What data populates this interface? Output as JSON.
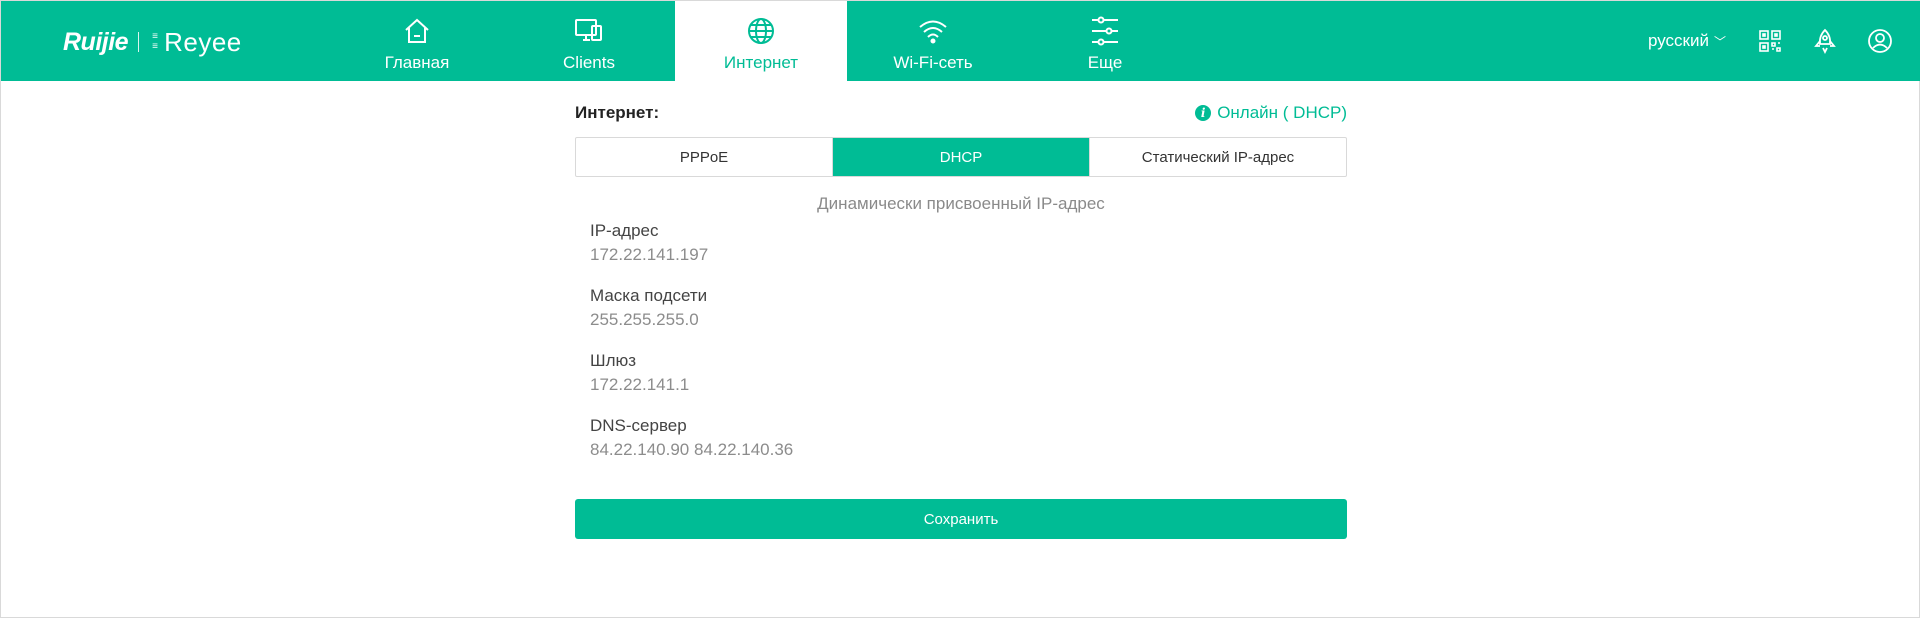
{
  "brand": {
    "logo_primary": "Ruijie",
    "logo_secondary": "Reyee",
    "primary_color": "#00bc95"
  },
  "nav": {
    "tabs": [
      {
        "label": "Главная",
        "icon": "home-icon",
        "active": false
      },
      {
        "label": "Clients",
        "icon": "monitor-icon",
        "active": false
      },
      {
        "label": "Интернет",
        "icon": "globe-icon",
        "active": true
      },
      {
        "label": "Wi-Fi-сеть",
        "icon": "wifi-icon",
        "active": false
      },
      {
        "label": "Еще",
        "icon": "settings-sliders-icon",
        "active": false
      }
    ]
  },
  "toolbar": {
    "language": "русский",
    "icons": [
      "qr-code-icon",
      "rocket-icon",
      "user-icon"
    ]
  },
  "internet": {
    "title": "Интернет:",
    "status": "Онлайн ( DHCP)",
    "modes": [
      "PPPoE",
      "DHCP",
      "Статический IP-адрес"
    ],
    "active_mode": "DHCP",
    "subtitle": "Динамически присвоенный IP-адрес",
    "fields": [
      {
        "label": "IP-адрес",
        "value": "172.22.141.197"
      },
      {
        "label": "Маска подсети",
        "value": "255.255.255.0"
      },
      {
        "label": "Шлюз",
        "value": "172.22.141.1"
      },
      {
        "label": "DNS-сервер",
        "value": "84.22.140.90 84.22.140.36"
      }
    ],
    "save_label": "Сохранить"
  }
}
